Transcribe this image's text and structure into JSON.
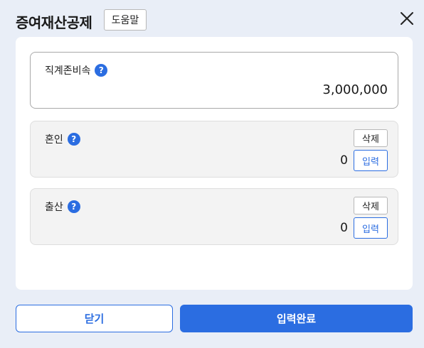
{
  "header": {
    "title": "증여재산공제",
    "help_label": "도움말",
    "close_icon": "close-icon"
  },
  "cards": {
    "lineal": {
      "label": "직계존비속",
      "help_icon": "?",
      "amount": "3,000,000"
    },
    "marriage": {
      "label": "혼인",
      "help_icon": "?",
      "delete_label": "삭제",
      "amount": "0",
      "input_label": "입력"
    },
    "birth": {
      "label": "출산",
      "help_icon": "?",
      "delete_label": "삭제",
      "amount": "0",
      "input_label": "입력"
    }
  },
  "footer": {
    "close_label": "닫기",
    "done_label": "입력완료"
  },
  "colors": {
    "accent": "#2b6de1",
    "background": "#e9eef7"
  }
}
